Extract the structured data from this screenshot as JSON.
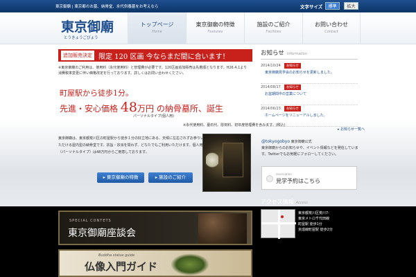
{
  "topbar": {
    "crumb": "東京御廟 | 東京都のお墓、納骨堂、永代供養墓をお考えなら",
    "font_size_label": "文字サイズ",
    "font_normal": "標準",
    "font_large": "拡大"
  },
  "header": {
    "logo_main": "東京御廟",
    "logo_sub": "とうきょうごびょう"
  },
  "nav": [
    {
      "jp": "トップページ",
      "en": "Home",
      "active": true
    },
    {
      "jp": "東京御廟の特徴",
      "en": "Features",
      "active": false
    },
    {
      "jp": "施設のご紹介",
      "en": "Facilities",
      "active": false
    },
    {
      "jp": "お問い合わせ",
      "en": "Contact",
      "active": false
    }
  ],
  "banner": {
    "tag": "追加販売決定",
    "message": "限定 120 区画 今ならまだ間に合います！"
  },
  "note1": {
    "line1": "※東京御廟のご利用は、使用料（永代使用料）と管理費が必要です。120区画追加販売は先着順となります。H26.4.1より",
    "line2": "消費税率変更に伴い価格改定を行っております。詳しくはお問い合わせください。"
  },
  "promo": {
    "line1": "町屋駅から徒歩1分。",
    "line2_pre": "先進・安心価格",
    "price": "48",
    "price_unit": "万円",
    "line2_post": "の納骨墓所、誕生",
    "sub": "パーソナルタイプ(個人用)"
  },
  "note2": "※永代使用料、墓石代、彫刻料、初年度管理費を含みます。(税込)",
  "body_text": "東京御廟は、東京都荒川区の町屋駅から徒歩１分の好立地にある、天候に左右されずお参りいただける屋内型の納骨堂です。宗旨・宗派を問わず、どなたでもご利用いただけます。個人用（パーソナルタイプ）は48万円からご用意しております。",
  "buttons": {
    "features": "▸ 東京御廟の特徴",
    "facilities": "▸ 施設のご紹介"
  },
  "news": {
    "title": "お知らせ",
    "title_en": "Information",
    "items": [
      {
        "date": "2014/10/24",
        "badge": "お知らせ",
        "title": "東京御廟見学会のお知らせを更新しました。"
      },
      {
        "date": "2014/08/17",
        "badge": "お知らせ",
        "title": "お盆期間中の営業について"
      },
      {
        "date": "2014/06/23",
        "badge": "お知らせ",
        "title": "ホームページをリニューアルしました。"
      }
    ],
    "more": "▸ お知らせ一覧へ"
  },
  "twitter": {
    "handle": "@tokyogobyo",
    "handle_suffix": " 東京御廟公式",
    "text": "東京御廟からのお知らせや、イベント情報などを発信しています。Twitterでもお気軽にフォローしてください。"
  },
  "reserve": {
    "en": "reservation",
    "jp": "見学予約はこちら"
  },
  "access": {
    "title": "アクセス情報",
    "title_en": "Access",
    "line1": "東京都荒川区荒川7-",
    "line2": "東京メトロ千代田線",
    "line3": "町屋駅 徒歩1分",
    "line4": "京成線町屋駅 徒歩2分"
  },
  "promo_band1": {
    "en": "SPECIAL CONTETS",
    "jp": "東京御廟座談会"
  },
  "promo_band2": {
    "en": "Buddha statue guide",
    "jp": "仏像入門ガイド"
  },
  "colors": {
    "brand_blue": "#1a4b8c",
    "accent_red": "#c8211c"
  }
}
